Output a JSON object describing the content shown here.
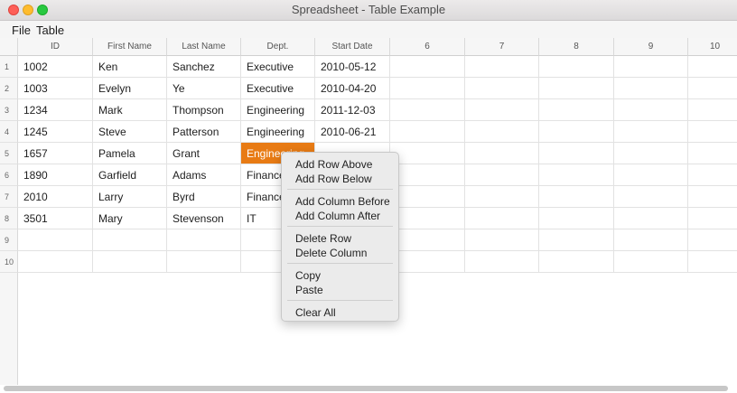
{
  "window": {
    "title": "Spreadsheet - Table Example"
  },
  "menubar": {
    "items": [
      "File",
      "Table"
    ]
  },
  "table": {
    "columns": [
      "ID",
      "First Name",
      "Last Name",
      "Dept.",
      "Start Date",
      "6",
      "7",
      "8",
      "9",
      "10"
    ],
    "row_numbers": [
      "1",
      "2",
      "3",
      "4",
      "5",
      "6",
      "7",
      "8",
      "9",
      "10"
    ],
    "rows": [
      [
        "1002",
        "Ken",
        "Sanchez",
        "Executive",
        "2010-05-12"
      ],
      [
        "1003",
        "Evelyn",
        "Ye",
        "Executive",
        "2010-04-20"
      ],
      [
        "1234",
        "Mark",
        "Thompson",
        "Engineering",
        "2011-12-03"
      ],
      [
        "1245",
        "Steve",
        "Patterson",
        "Engineering",
        "2010-06-21"
      ],
      [
        "1657",
        "Pamela",
        "Grant",
        "Engineering",
        ""
      ],
      [
        "1890",
        "Garfield",
        "Adams",
        "Finance",
        ""
      ],
      [
        "2010",
        "Larry",
        "Byrd",
        "Finance",
        ""
      ],
      [
        "3501",
        "Mary",
        "Stevenson",
        "IT",
        ""
      ],
      [
        "",
        "",
        "",
        "",
        ""
      ],
      [
        "",
        "",
        "",
        "",
        ""
      ]
    ],
    "selected_cell_color": "#e87b14"
  },
  "context_menu": {
    "groups": [
      [
        "Add Row Above",
        "Add Row Below"
      ],
      [
        "Add Column Before",
        "Add Column After"
      ],
      [
        "Delete Row",
        "Delete Column"
      ],
      [
        "Copy",
        "Paste"
      ],
      [
        "Clear All"
      ]
    ]
  }
}
